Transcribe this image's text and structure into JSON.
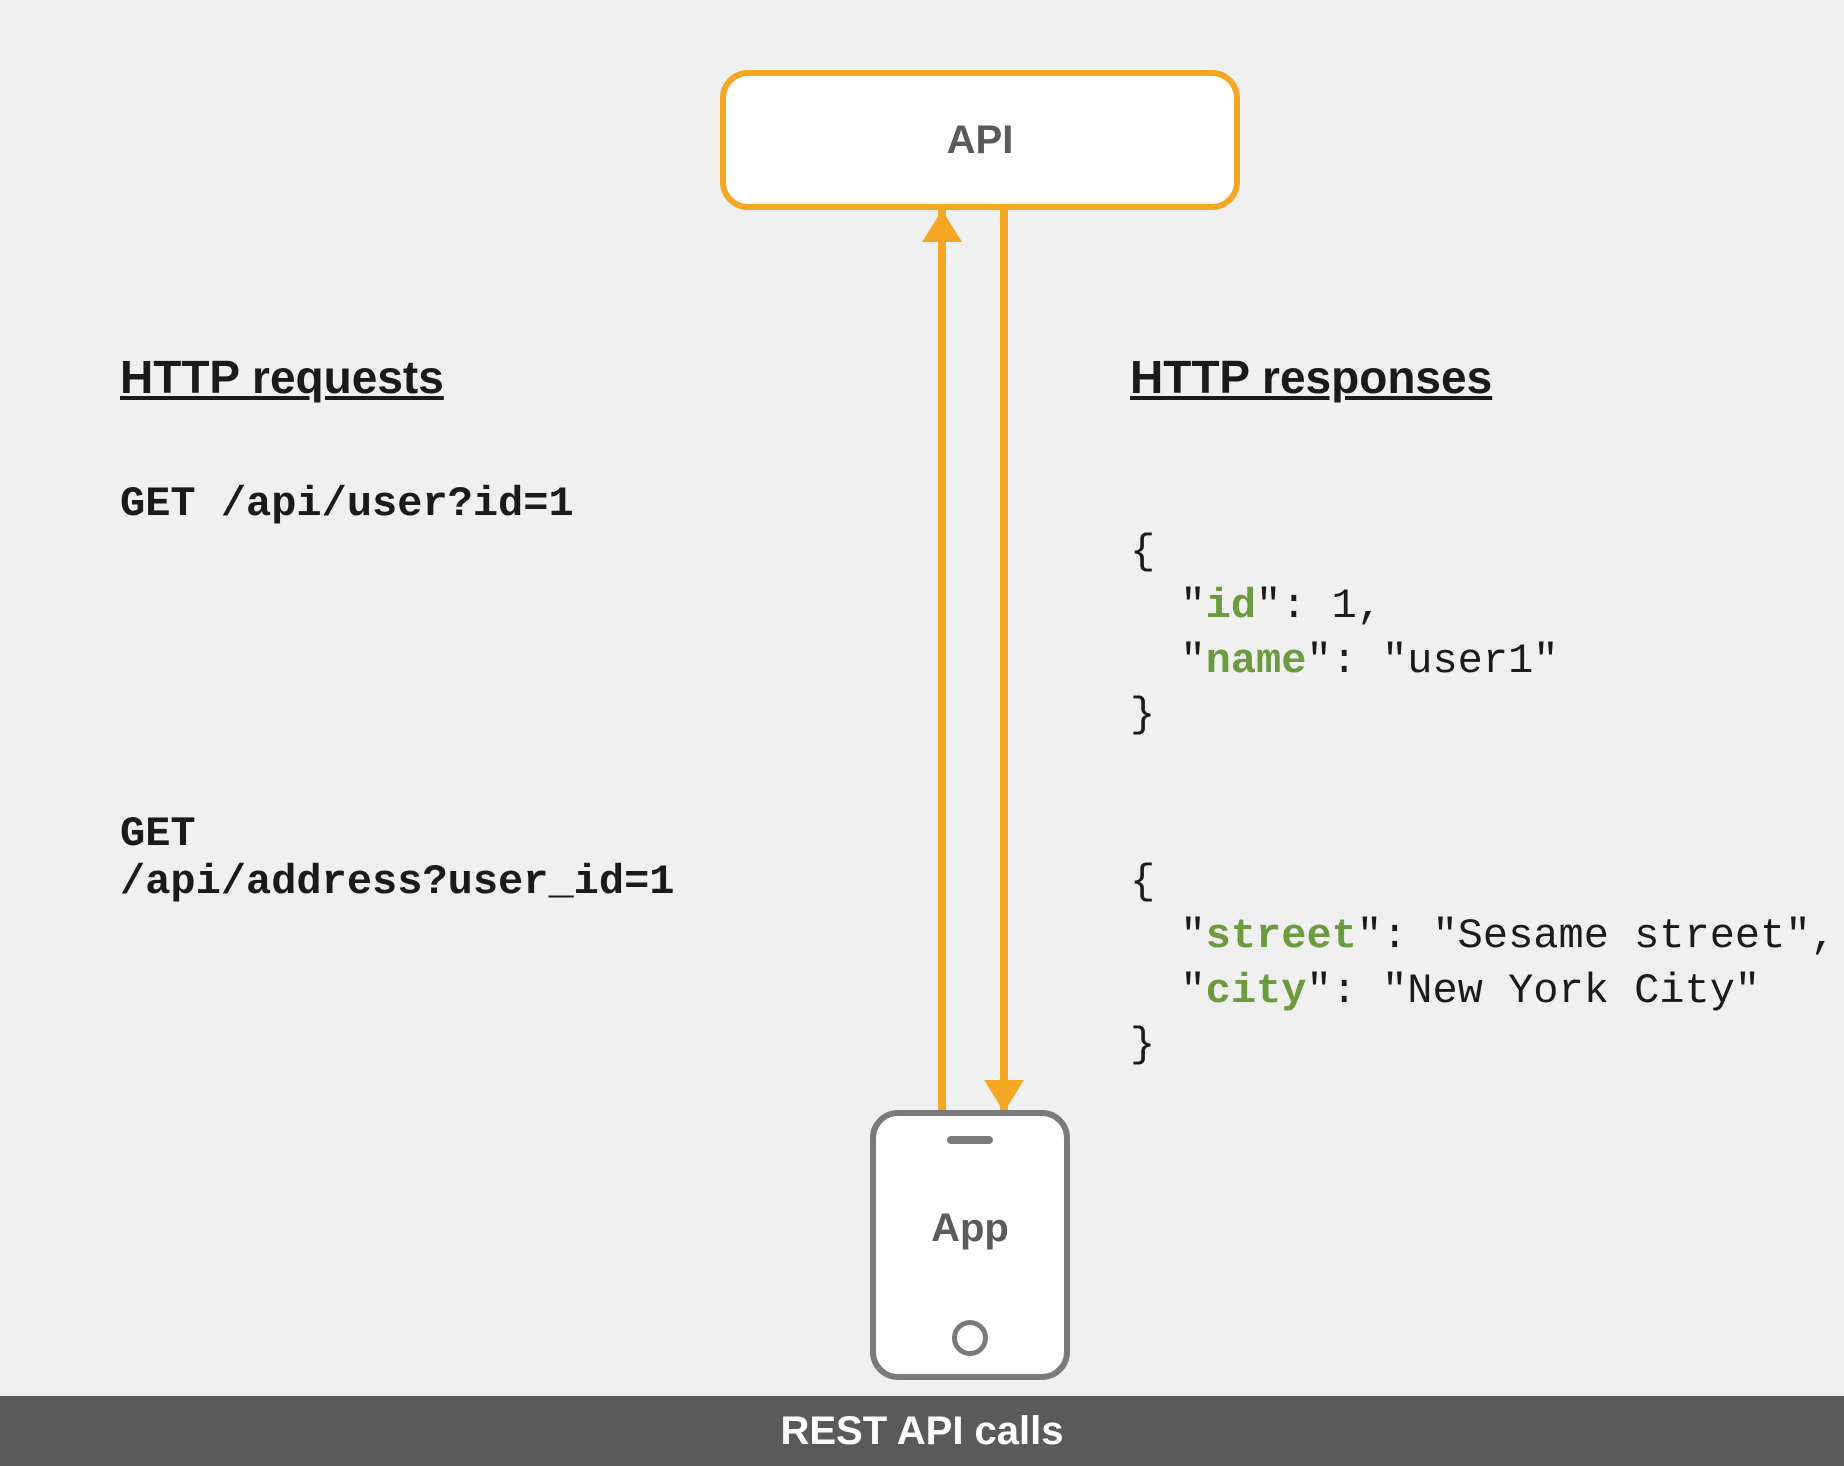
{
  "nodes": {
    "api": "API",
    "app": "App"
  },
  "headings": {
    "requests": "HTTP requests",
    "responses": "HTTP responses"
  },
  "requests": [
    "GET /api/user?id=1",
    "GET\n/api/address?user_id=1"
  ],
  "responses": [
    {
      "id": 1,
      "name": "user1"
    },
    {
      "street": "Sesame street",
      "city": "New York City"
    }
  ],
  "response_text": {
    "r1_open": "{",
    "r1_l1a": "  \"",
    "r1_k1": "id",
    "r1_l1b": "\": 1,",
    "r1_l2a": "  \"",
    "r1_k2": "name",
    "r1_l2b": "\": \"user1\"",
    "r1_close": "}",
    "r2_open": "{",
    "r2_l1a": "  \"",
    "r2_k1": "street",
    "r2_l1b": "\": \"Sesame street\",",
    "r2_l2a": "  \"",
    "r2_k2": "city",
    "r2_l2b": "\": \"New York City\"",
    "r2_close": "}"
  },
  "footer": "REST API calls",
  "colors": {
    "accent": "#f5a623",
    "device": "#7a7a7a",
    "footer_bg": "#5a5a5a",
    "json_key": "#6b9b3e"
  }
}
